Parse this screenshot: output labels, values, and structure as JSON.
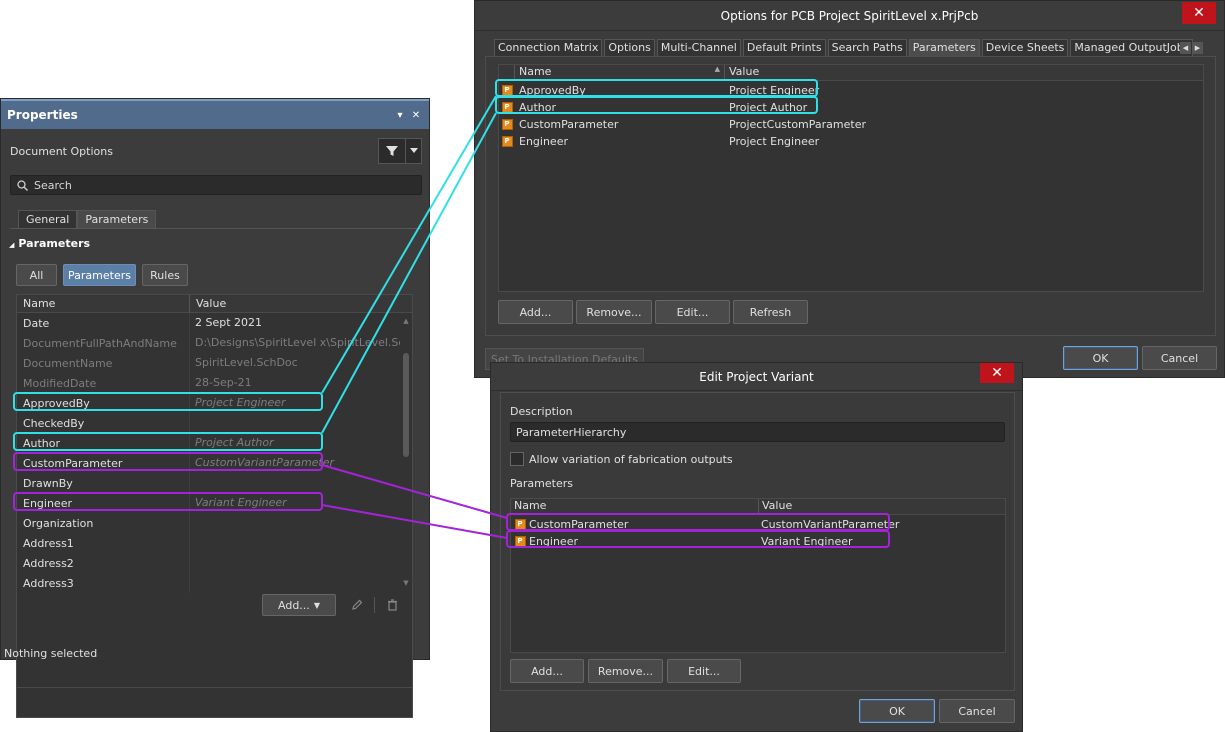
{
  "properties": {
    "title": "Properties",
    "pin_glyph": "▾",
    "close_glyph": "✕",
    "document_options": "Document Options",
    "search_placeholder": "Search",
    "tabs": [
      "General",
      "Parameters"
    ],
    "section": "Parameters",
    "section_glyph": "◢",
    "filter_pills": [
      "All",
      "Parameters",
      "Rules"
    ],
    "columns": [
      "Name",
      "Value"
    ],
    "rows": [
      {
        "name": "Date",
        "value": "2 Sept 2021"
      },
      {
        "name": "DocumentFullPathAndName",
        "value": "D:\\Designs\\SpiritLevel x\\SpiritLevel.Sc..."
      },
      {
        "name": "DocumentName",
        "value": "SpiritLevel.SchDoc"
      },
      {
        "name": "ModifiedDate",
        "value": "28-Sep-21"
      },
      {
        "name": "ApprovedBy",
        "value": "Project Engineer"
      },
      {
        "name": "CheckedBy",
        "value": ""
      },
      {
        "name": "Author",
        "value": "Project Author"
      },
      {
        "name": "CustomParameter",
        "value": "CustomVariantParameter"
      },
      {
        "name": "DrawnBy",
        "value": ""
      },
      {
        "name": "Engineer",
        "value": "Variant Engineer"
      },
      {
        "name": "Organization",
        "value": ""
      },
      {
        "name": "Address1",
        "value": ""
      },
      {
        "name": "Address2",
        "value": ""
      },
      {
        "name": "Address3",
        "value": ""
      }
    ],
    "add_button": "Add...",
    "dropdown_glyph": "▼",
    "status": "Nothing selected"
  },
  "options_dialog": {
    "title": "Options for PCB Project SpiritLevel x.PrjPcb",
    "close_glyph": "✕",
    "tabs": [
      "Connection Matrix",
      "Options",
      "Multi-Channel",
      "Default Prints",
      "Search Paths",
      "Parameters",
      "Device Sheets",
      "Managed OutputJobs"
    ],
    "tab_scroll": [
      "◀",
      "▶"
    ],
    "columns": [
      "Name",
      "Value"
    ],
    "sort_glyph": "▲",
    "param_icon": "P",
    "rows": [
      {
        "name": "ApprovedBy",
        "value": "Project Engineer"
      },
      {
        "name": "Author",
        "value": "Project Author"
      },
      {
        "name": "CustomParameter",
        "value": "ProjectCustomParameter"
      },
      {
        "name": "Engineer",
        "value": "Project Engineer"
      }
    ],
    "buttons": {
      "add": "Add...",
      "remove": "Remove...",
      "edit": "Edit...",
      "refresh": "Refresh"
    },
    "set_defaults": "Set To Installation Defaults",
    "ok": "OK",
    "cancel": "Cancel"
  },
  "variant_dialog": {
    "title": "Edit Project Variant",
    "close_glyph": "✕",
    "description_label": "Description",
    "description_value": "ParameterHierarchy",
    "allow_variation_label": "Allow variation of fabrication outputs",
    "allow_variation_checked": false,
    "parameters_label": "Parameters",
    "columns": [
      "Name",
      "Value"
    ],
    "param_icon": "P",
    "rows": [
      {
        "name": "CustomParameter",
        "value": "CustomVariantParameter"
      },
      {
        "name": "Engineer",
        "value": "Variant Engineer"
      }
    ],
    "buttons": {
      "add": "Add...",
      "remove": "Remove...",
      "edit": "Edit..."
    },
    "ok": "OK",
    "cancel": "Cancel"
  },
  "colors": {
    "project_highlight": "#2fe0e6",
    "variant_highlight": "#a323d8",
    "panel_bg": "#3c3c3c",
    "title_bar": "#516b8c",
    "close_red": "#c0141c",
    "param_icon_orange": "#e38a1c"
  }
}
